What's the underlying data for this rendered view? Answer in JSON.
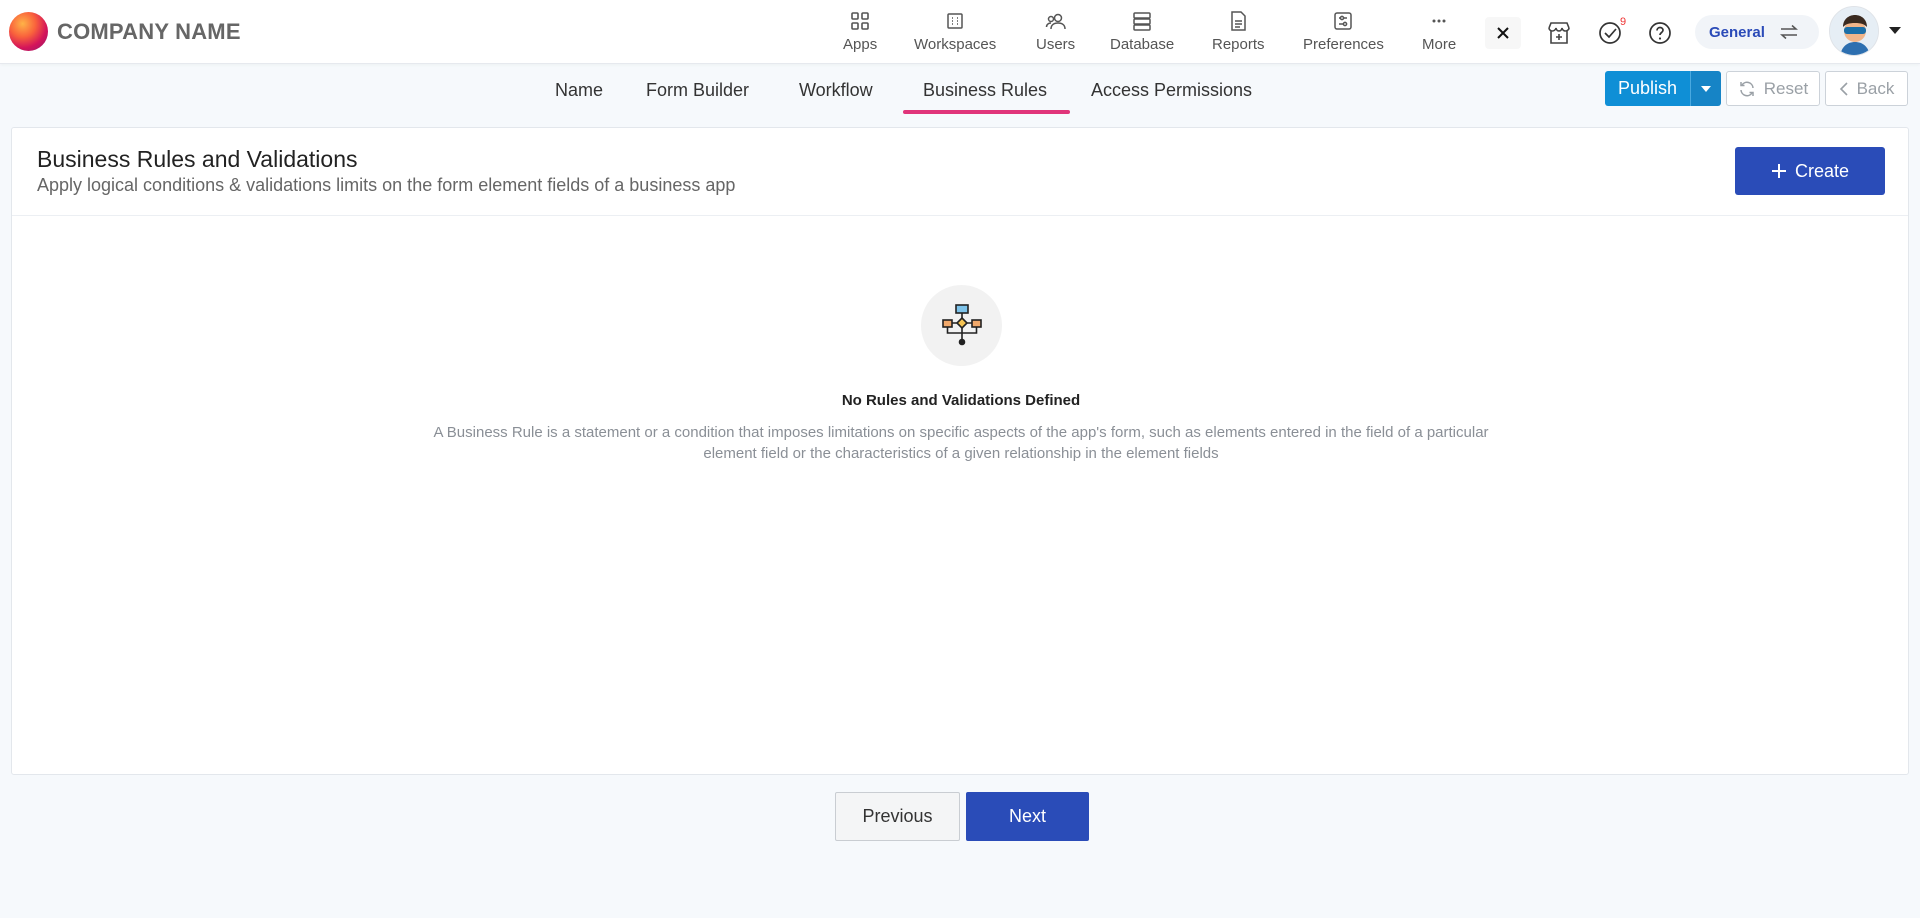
{
  "brand": {
    "name": "COMPANY NAME"
  },
  "nav": [
    {
      "label": "Apps",
      "icon": "grid-icon"
    },
    {
      "label": "Workspaces",
      "icon": "building-icon"
    },
    {
      "label": "Users",
      "icon": "users-icon"
    },
    {
      "label": "Database",
      "icon": "database-icon"
    },
    {
      "label": "Reports",
      "icon": "report-icon"
    },
    {
      "label": "Preferences",
      "icon": "preferences-icon"
    },
    {
      "label": "More",
      "icon": "more-icon"
    }
  ],
  "header": {
    "notifications_count": "9",
    "workspace_switch_label": "General"
  },
  "tabs": [
    {
      "label": "Name"
    },
    {
      "label": "Form Builder"
    },
    {
      "label": "Workflow"
    },
    {
      "label": "Business Rules",
      "active": true
    },
    {
      "label": "Access Permissions"
    }
  ],
  "actions": {
    "publish_label": "Publish",
    "reset_label": "Reset",
    "back_label": "Back"
  },
  "card": {
    "title": "Business Rules and Validations",
    "subtitle": "Apply logical conditions & validations limits on the form element fields of a business app",
    "create_label": "Create",
    "empty_title": "No Rules and Validations Defined",
    "empty_description": "A Business Rule is a statement or a condition that imposes limitations on specific aspects of the app's form, such as elements entered in the field of a particular element field or the characteristics of a given relationship in the element fields"
  },
  "footer": {
    "previous_label": "Previous",
    "next_label": "Next"
  },
  "colors": {
    "accent": "#2a4cb8",
    "publish": "#0f8fd6",
    "active_tab_underline": "#e0357a"
  }
}
